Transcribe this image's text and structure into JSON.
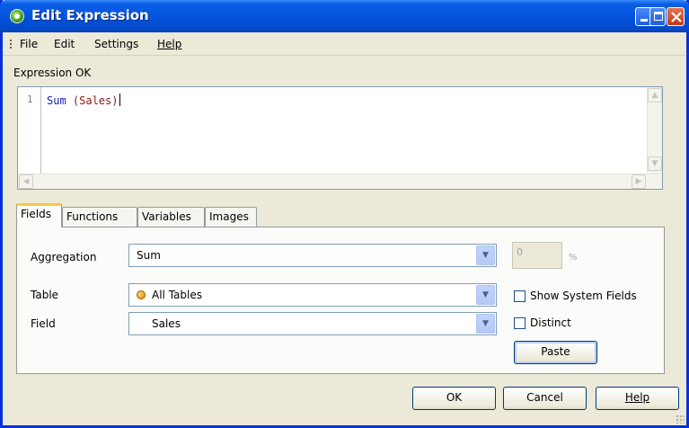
{
  "window": {
    "title": "Edit Expression",
    "controls": {
      "minimize": "minimize-icon",
      "maximize": "maximize-icon",
      "close": "close-icon"
    }
  },
  "menu": [
    "File",
    "Edit",
    "Settings",
    "Help"
  ],
  "status": "Expression OK",
  "editor": {
    "line_number": "1",
    "code_function": "Sum",
    "code_field": "(Sales)"
  },
  "tabs": [
    "Fields",
    "Functions",
    "Variables",
    "Images"
  ],
  "fields_tab": {
    "aggregation_label": "Aggregation",
    "aggregation_value": "Sum",
    "percent_value": "0",
    "percent_unit": "%",
    "table_label": "Table",
    "table_value": "All Tables",
    "field_label": "Field",
    "field_value": "Sales",
    "show_system_fields_label": "Show System Fields",
    "show_system_fields_checked": false,
    "distinct_label": "Distinct",
    "distinct_checked": false,
    "paste_label": "Paste"
  },
  "buttons": {
    "ok": "OK",
    "cancel": "Cancel",
    "help": "Help"
  },
  "colors": {
    "titlebar": "#0454dd",
    "dialog_bg": "#ece9d8",
    "code_function": "#1b1bb0",
    "code_field": "#8b1a1a",
    "active_tab_accent": "#ffc83c"
  }
}
